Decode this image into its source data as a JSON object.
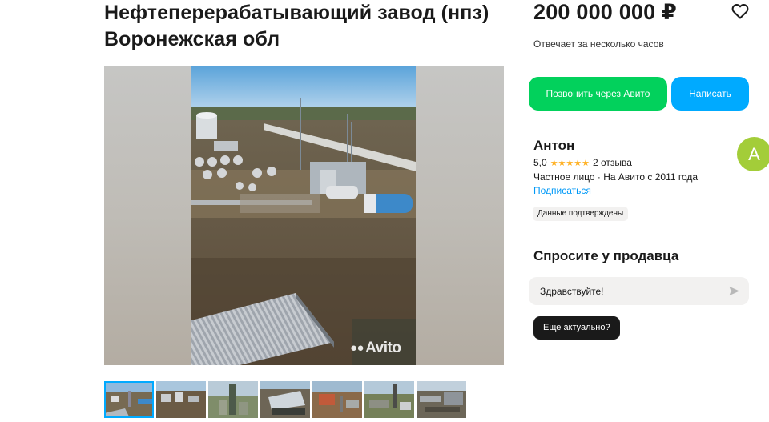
{
  "listing": {
    "title": "Нефтеперерабатывающий завод (нпз) Воронежская обл",
    "price": "200 000 000 ₽",
    "reply_time": "Отвечает за несколько часов"
  },
  "actions": {
    "call_label": "Позвонить через Авито",
    "write_label": "Написать"
  },
  "gallery": {
    "watermark": "Avito",
    "thumbnail_count": 7,
    "active_index": 0
  },
  "seller": {
    "name": "Антон",
    "rating": "5,0",
    "stars": "★★★★★",
    "reviews": "2 отзыва",
    "type": "Частное лицо · На Авито с 2011 года",
    "subscribe_label": "Подписаться",
    "verified_label": "Данные подтверждены",
    "avatar_letter": "А"
  },
  "ask": {
    "title": "Спросите у продавца",
    "message_value": "Здравствуйте!",
    "quick_reply": "Еще актуально?"
  },
  "colors": {
    "green": "#02d15c",
    "blue": "#00aaff",
    "avatar": "#a3cd39",
    "stars": "#ffb021",
    "link": "#0099f7"
  }
}
